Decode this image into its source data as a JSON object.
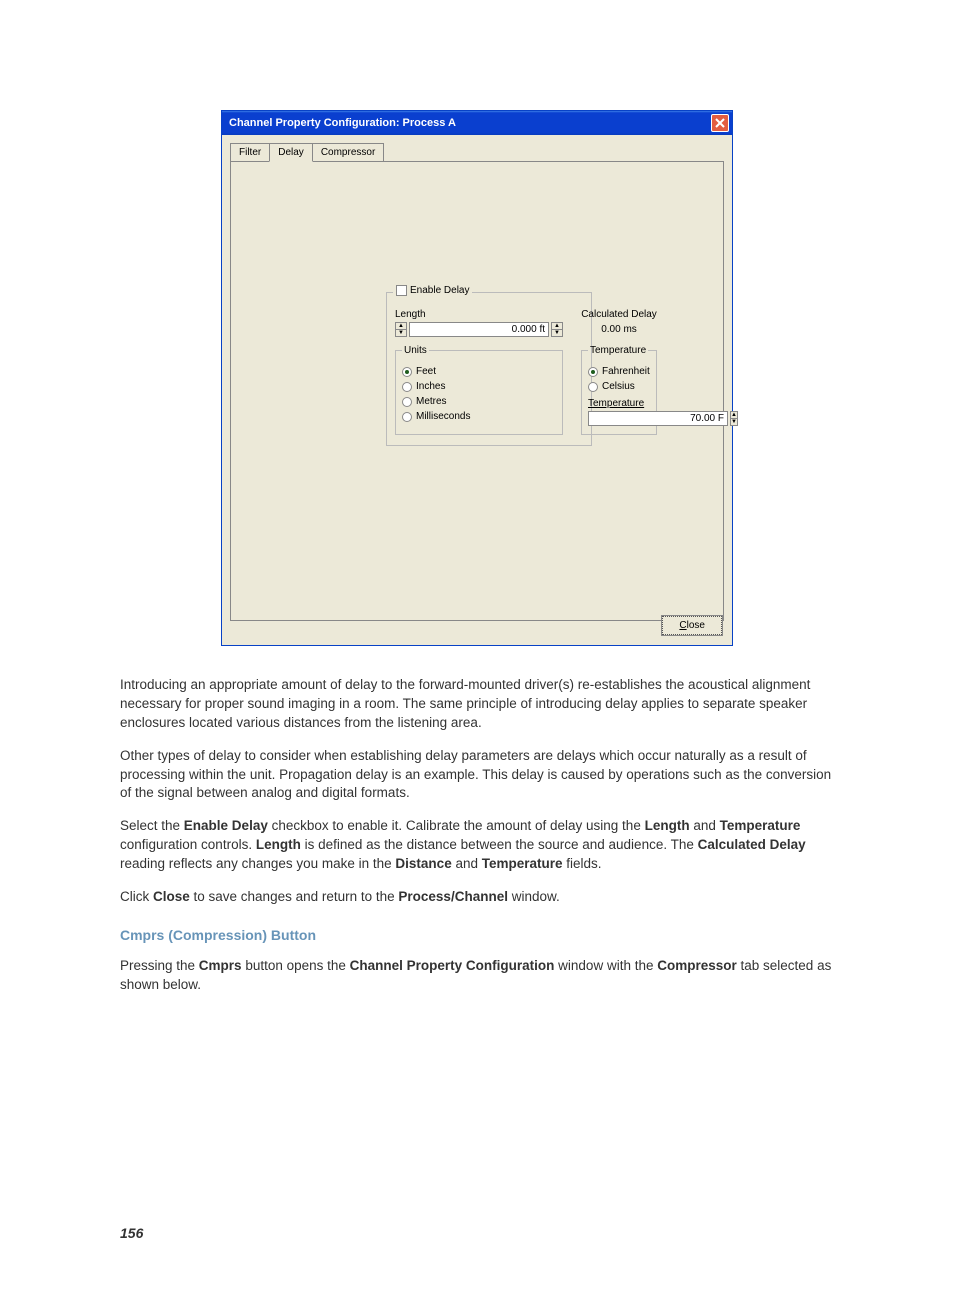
{
  "dialog": {
    "title": "Channel Property Configuration: Process A",
    "tabs": {
      "filter": "Filter",
      "delay": "Delay",
      "compressor": "Compressor"
    },
    "enable_delay_label": "Enable Delay",
    "length_label": "Length",
    "length_value": "0.000 ft",
    "calc_delay_label": "Calculated Delay",
    "calc_delay_value": "0.00 ms",
    "units_legend": "Units",
    "units": {
      "feet": "Feet",
      "inches": "Inches",
      "metres": "Metres",
      "ms": "Milliseconds"
    },
    "temp_legend": "Temperature",
    "temp_scales": {
      "f": "Fahrenheit",
      "c": "Celsius"
    },
    "temp_label": "Temperature",
    "temp_value": "70.00 F",
    "close_btn": "Close",
    "close_underline": "C"
  },
  "doc": {
    "p1": "Introducing an appropriate amount of delay to the forward-mounted driver(s) re-establishes the acoustical alignment necessary for proper sound imaging in a room. The same principle of introducing delay applies to separate speaker enclosures located various distances from the listening area.",
    "p2": "Other types of delay to consider when establishing delay parameters are delays which occur naturally as a result of processing within the unit. Propagation delay is an example. This delay is caused by operations such as the conversion of the signal between analog and digital formats.",
    "p3a": "Select the ",
    "p3b": "Enable Delay",
    "p3c": " checkbox to enable it. Calibrate the amount of delay using the ",
    "p3d": "Length",
    "p3e": " and ",
    "p3f": "Temperature",
    "p3g": " configuration controls. ",
    "p3h": "Length",
    "p3i": " is defined as the distance between the source and audience. The ",
    "p3j": "Calculated Delay",
    "p3k": " reading reflects any changes you make in the ",
    "p3l": "Distance",
    "p3m": " and ",
    "p3n": "Temperature",
    "p3o": " fields.",
    "p4a": "Click ",
    "p4b": "Close",
    "p4c": " to save changes and return to the ",
    "p4d": "Process/Channel",
    "p4e": " window.",
    "heading": "Cmprs (Compression) Button",
    "p5a": "Pressing the ",
    "p5b": "Cmprs",
    "p5c": " button opens the ",
    "p5d": "Channel Property Configuration",
    "p5e": " window with the ",
    "p5f": "Compressor",
    "p5g": " tab selected as shown below.",
    "page_num": "156"
  }
}
